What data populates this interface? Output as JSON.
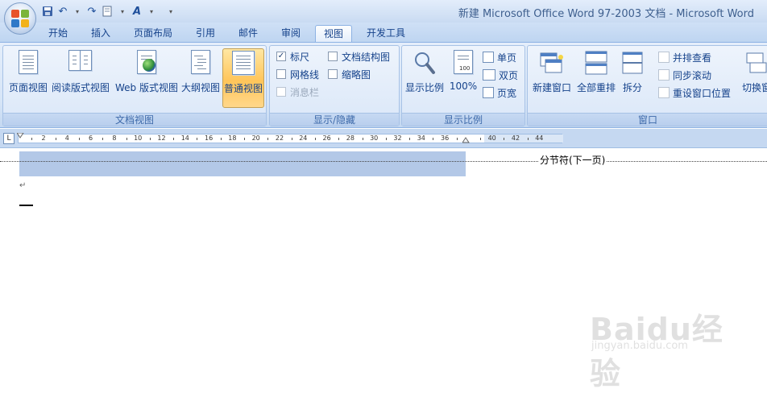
{
  "window": {
    "title": "新建 Microsoft Office Word 97-2003 文档 - Microsoft Word"
  },
  "quick_access": [
    "save-icon",
    "undo-icon",
    "redo-icon",
    "print-preview-icon",
    "font-color-icon",
    "customize-icon"
  ],
  "tabs": [
    {
      "label": "开始",
      "active": false
    },
    {
      "label": "插入",
      "active": false
    },
    {
      "label": "页面布局",
      "active": false
    },
    {
      "label": "引用",
      "active": false
    },
    {
      "label": "邮件",
      "active": false
    },
    {
      "label": "审阅",
      "active": false
    },
    {
      "label": "视图",
      "active": true
    },
    {
      "label": "开发工具",
      "active": false
    }
  ],
  "groups": {
    "doc_views": {
      "label": "文档视图",
      "buttons": {
        "page": "页面视图",
        "reading": "阅读版式视图",
        "web": "Web 版式视图",
        "outline": "大纲视图",
        "normal": "普通视图"
      },
      "active": "普通视图"
    },
    "show_hide": {
      "label": "显示/隐藏",
      "ruler": {
        "label": "标尺",
        "checked": true
      },
      "gridlines": {
        "label": "网格线",
        "checked": false
      },
      "message_bar": {
        "label": "消息栏",
        "checked": false,
        "disabled": true
      },
      "doc_map": {
        "label": "文档结构图",
        "checked": false
      },
      "thumbnails": {
        "label": "缩略图",
        "checked": false
      }
    },
    "zoom": {
      "label": "显示比例",
      "zoom": "显示比例",
      "hundred": "100%",
      "one_page": "单页",
      "two_pages": "双页",
      "page_width": "页宽"
    },
    "window": {
      "label": "窗口",
      "new_window": "新建窗口",
      "arrange_all": "全部重排",
      "split": "拆分",
      "side_by_side": "并排查看",
      "sync_scroll": "同步滚动",
      "reset_position": "重设窗口位置",
      "switch_windows": "切换窗"
    }
  },
  "ruler": {
    "corner": "L",
    "ticks": [
      "2",
      "4",
      "6",
      "8",
      "10",
      "12",
      "14",
      "16",
      "18",
      "20",
      "22",
      "24",
      "26",
      "28",
      "30",
      "32",
      "34",
      "36",
      "",
      "40",
      "42",
      "44"
    ]
  },
  "document": {
    "section_break": "分节符(下一页)",
    "para_mark": "↵"
  },
  "watermark": {
    "text": "Baidu经验",
    "sub": "jingyan.baidu.com"
  },
  "colors": {
    "ribbon": "#d6e5f7",
    "active_button": "#ffc55a",
    "selection": "#b3c8e7"
  }
}
